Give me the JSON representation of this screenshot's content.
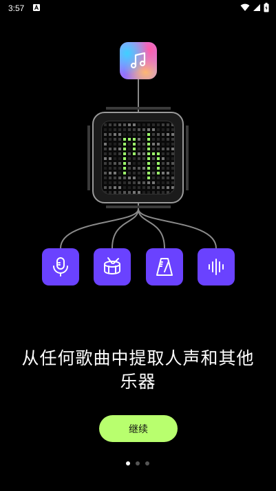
{
  "status_bar": {
    "time": "3:57",
    "notification_icon": "a-icon",
    "icons": [
      "wifi-icon",
      "signal-icon",
      "battery-icon"
    ]
  },
  "app_icon": {
    "icon": "music-note-icon"
  },
  "tools": [
    {
      "name": "microphone",
      "icon": "microphone-icon"
    },
    {
      "name": "drum",
      "icon": "drum-icon"
    },
    {
      "name": "metronome",
      "icon": "metronome-icon"
    },
    {
      "name": "waveform",
      "icon": "waveform-icon"
    }
  ],
  "headline": "从任何歌曲中提取人声和其他乐器",
  "continue_label": "继续",
  "pager": {
    "count": 3,
    "active": 1
  },
  "colors": {
    "background": "#000000",
    "tool_button": "#6a42ff",
    "continue_button": "#b8ff6e",
    "led_green": "#9cff6a"
  }
}
